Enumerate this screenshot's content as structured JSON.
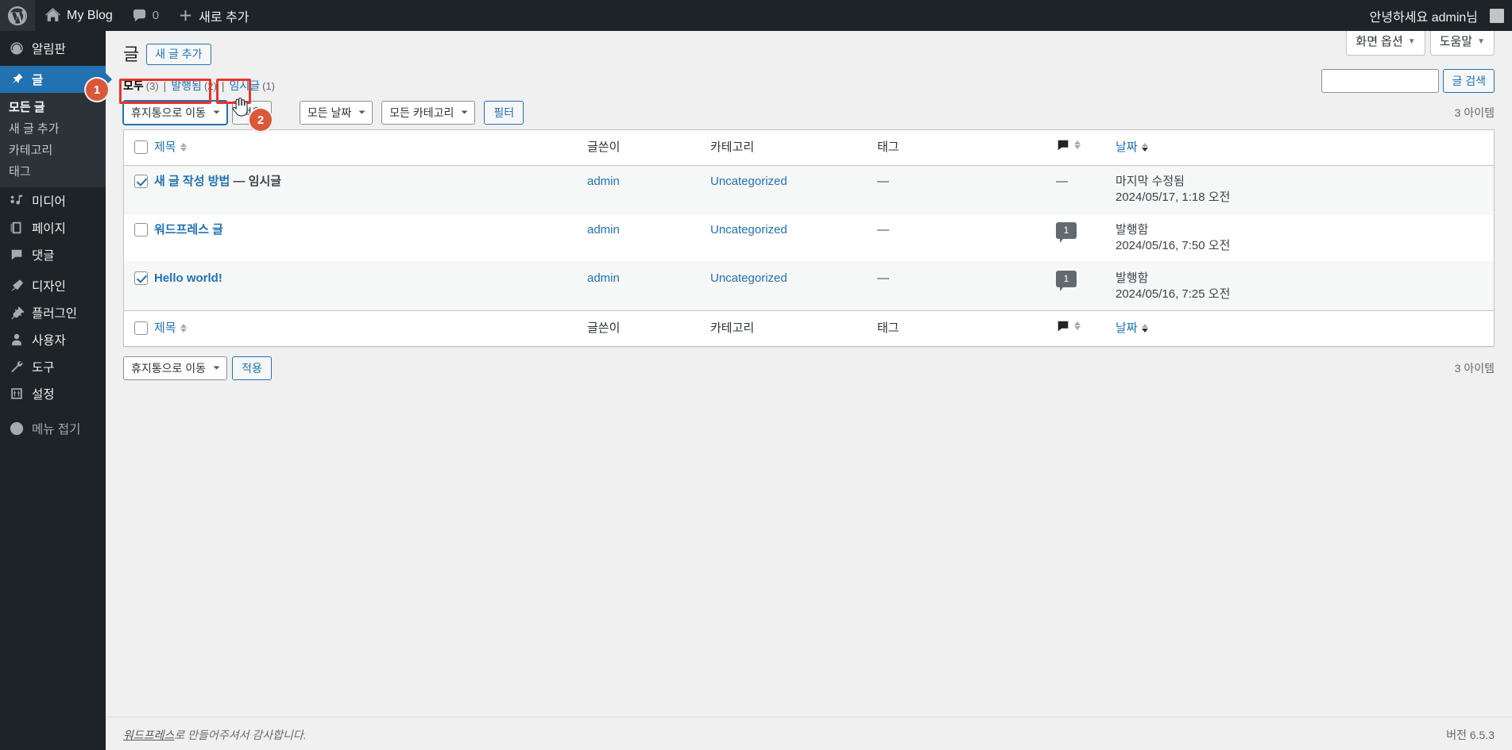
{
  "adminbar": {
    "wp_logo": "wordpress-logo-icon",
    "site_name": "My Blog",
    "comments_count": "0",
    "new_label": "새로 추가",
    "howdy": "안녕하세요 admin님"
  },
  "sidebar": {
    "items": [
      {
        "label": "알림판",
        "icon": "dashboard-icon",
        "current": false
      },
      {
        "label": "글",
        "icon": "pin-icon",
        "current": true
      },
      {
        "label": "미디어",
        "icon": "media-icon",
        "current": false
      },
      {
        "label": "페이지",
        "icon": "page-icon",
        "current": false
      },
      {
        "label": "댓글",
        "icon": "comment-icon",
        "current": false
      },
      {
        "label": "디자인",
        "icon": "appearance-brush-icon",
        "current": false
      },
      {
        "label": "플러그인",
        "icon": "plugin-plug-icon",
        "current": false
      },
      {
        "label": "사용자",
        "icon": "users-icon",
        "current": false
      },
      {
        "label": "도구",
        "icon": "tools-wrench-icon",
        "current": false
      },
      {
        "label": "설정",
        "icon": "settings-sliders-icon",
        "current": false
      }
    ],
    "posts_submenu": [
      {
        "label": "모든 글",
        "current": true
      },
      {
        "label": "새 글 추가",
        "current": false
      },
      {
        "label": "카테고리",
        "current": false
      },
      {
        "label": "태그",
        "current": false
      }
    ],
    "collapse_label": "메뉴 접기"
  },
  "screen_meta": {
    "screen_options": "화면 옵션",
    "help": "도움말"
  },
  "page": {
    "title": "글",
    "add_new": "새 글 추가"
  },
  "search": {
    "value": "",
    "placeholder": "",
    "button": "글 검색"
  },
  "status_links": [
    {
      "label": "모두",
      "count": "(3)",
      "current": true
    },
    {
      "label": "발행됨",
      "count": "(2)",
      "current": false
    },
    {
      "label": "임시글",
      "count": "(1)",
      "current": false
    }
  ],
  "tablenav_top": {
    "bulk_action_selected": "휴지통으로 이동",
    "apply_label": "적용",
    "date_filter_selected": "모든 날짜",
    "category_filter_selected": "모든 카테고리",
    "filter_label": "필터",
    "displaying_num": "3 아이템"
  },
  "tablenav_bottom": {
    "bulk_action_selected": "휴지통으로 이동",
    "apply_label": "적용",
    "displaying_num": "3 아이템"
  },
  "table": {
    "columns": {
      "title": "제목",
      "author": "글쓴이",
      "categories": "카테고리",
      "tags": "태그",
      "comments": "comment-icon",
      "date": "날짜"
    },
    "rows": [
      {
        "checked": true,
        "title": "새 글 작성 방법",
        "state": "— 임시글",
        "author": "admin",
        "category": "Uncategorized",
        "tags": "—",
        "comments": "—",
        "comments_has_bubble": false,
        "date_status": "마지막 수정됨",
        "date_value": "2024/05/17, 1:18 오전"
      },
      {
        "checked": false,
        "title": "워드프레스 글",
        "state": "",
        "author": "admin",
        "category": "Uncategorized",
        "tags": "—",
        "comments": "1",
        "comments_has_bubble": true,
        "date_status": "발행함",
        "date_value": "2024/05/16, 7:50 오전"
      },
      {
        "checked": true,
        "title": "Hello world!",
        "state": "",
        "author": "admin",
        "category": "Uncategorized",
        "tags": "—",
        "comments": "1",
        "comments_has_bubble": true,
        "date_status": "발행함",
        "date_value": "2024/05/16, 7:25 오전"
      }
    ]
  },
  "annotations": {
    "step1": "1",
    "step2": "2",
    "highlight_color": "#e8352b",
    "badge_color": "#d9583a"
  },
  "footer": {
    "thanks_link": "워드프레스",
    "thanks_text": "로 만들어주셔서 감사합니다.",
    "version": "버전 6.5.3"
  }
}
